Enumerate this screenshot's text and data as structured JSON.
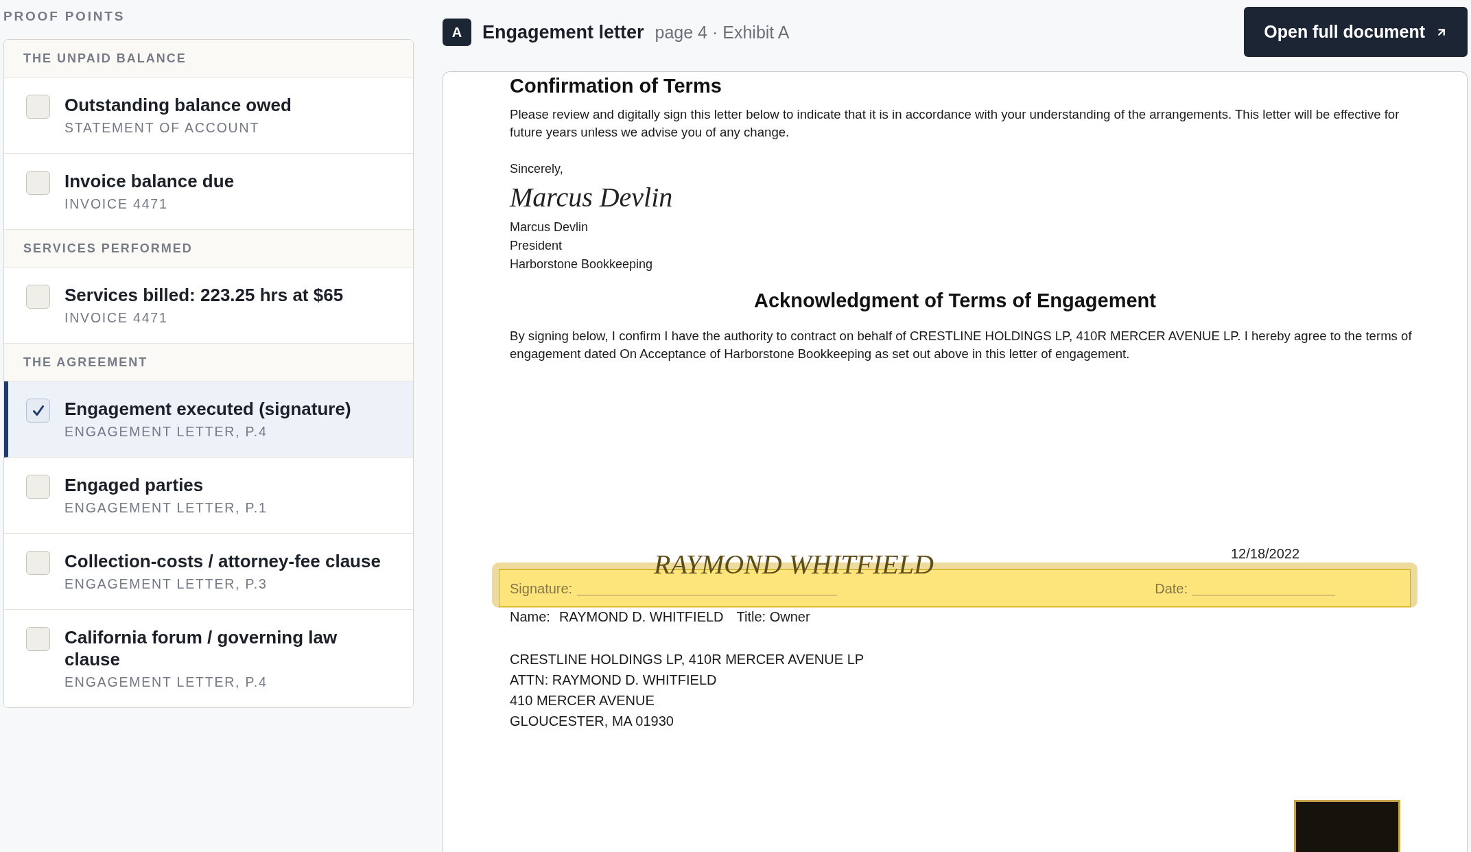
{
  "sidebar": {
    "heading": "PROOF POINTS",
    "sections": [
      {
        "title": "THE UNPAID BALANCE",
        "items": [
          {
            "title": "Outstanding balance owed",
            "source": "STATEMENT OF ACCOUNT",
            "checked": false,
            "selected": false
          },
          {
            "title": "Invoice balance due",
            "source": "INVOICE 4471",
            "checked": false,
            "selected": false
          }
        ]
      },
      {
        "title": "SERVICES PERFORMED",
        "items": [
          {
            "title": "Services billed: 223.25 hrs at $65",
            "source": "INVOICE 4471",
            "checked": false,
            "selected": false
          }
        ]
      },
      {
        "title": "THE AGREEMENT",
        "items": [
          {
            "title": "Engagement executed (signature)",
            "source": "ENGAGEMENT LETTER, P.4",
            "checked": true,
            "selected": true
          },
          {
            "title": "Engaged parties",
            "source": "ENGAGEMENT LETTER, P.1",
            "checked": false,
            "selected": false
          },
          {
            "title": "Collection-costs / attorney-fee clause",
            "source": "ENGAGEMENT LETTER, P.3",
            "checked": false,
            "selected": false
          },
          {
            "title": "California forum / governing law clause",
            "source": "ENGAGEMENT LETTER, P.4",
            "checked": false,
            "selected": false
          }
        ]
      }
    ]
  },
  "viewer": {
    "exhibit_badge": "A",
    "title": "Engagement letter",
    "page_reference": "page 4 · Exhibit A",
    "open_button": "Open full document"
  },
  "document": {
    "confirmation_title": "Confirmation of Terms",
    "confirmation_text": "Please review and digitally sign this letter below to indicate that it is in accordance with your understanding of the arrangements. This letter will be effective for future years unless we advise you of any change.",
    "closing": "Sincerely,",
    "sender_signature": "Marcus Devlin",
    "sender_lines": [
      "Marcus Devlin",
      "President",
      "Harborstone Bookkeeping"
    ],
    "acknowledgment_title": "Acknowledgment of Terms of Engagement",
    "acknowledgment_text": "By signing below, I confirm I have the authority to contract on behalf of CRESTLINE HOLDINGS LP, 410R MERCER AVENUE LP. I hereby agree to the terms of engagement dated On Acceptance of Harborstone Bookkeeping as set out above in this letter of engagement.",
    "signed_date": "12/18/2022",
    "signer_signature": "RAYMOND WHITFIELD",
    "signature_field": {
      "highlighted": true,
      "signature_label": "Signature:",
      "date_label": "Date:"
    },
    "name_line": {
      "name_label": "Name:",
      "name": "RAYMOND D. WHITFIELD",
      "title": "Title: Owner"
    },
    "address_lines": [
      "CRESTLINE HOLDINGS LP, 410R MERCER AVENUE LP",
      "ATTN: RAYMOND D. WHITFIELD",
      "410 MERCER AVENUE",
      "GLOUCESTER, MA 01930"
    ]
  }
}
